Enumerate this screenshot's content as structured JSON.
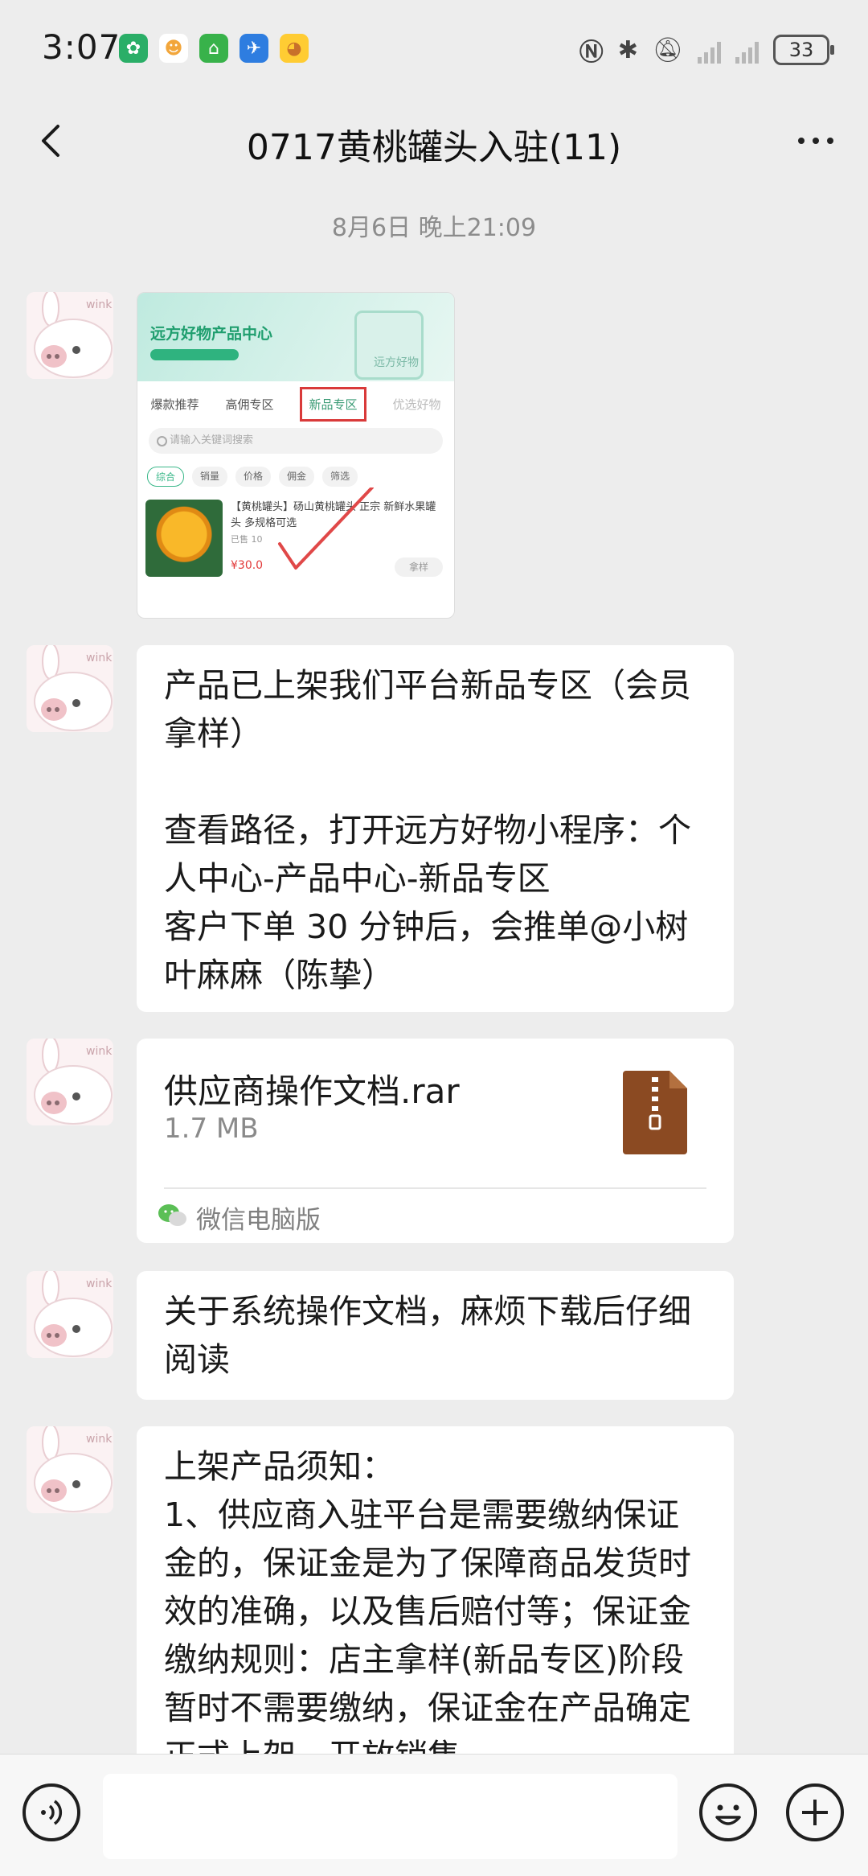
{
  "status_bar": {
    "time": "3:07",
    "battery": "33",
    "app_icons": [
      "wechat-pay-icon",
      "meituan-icon",
      "ctrip-icon",
      "flight-icon",
      "duck-app-icon"
    ],
    "icons": [
      "nfc-icon",
      "bluetooth-icon",
      "mute-icon",
      "signal-icon",
      "signal-icon"
    ]
  },
  "header": {
    "title": "0717黄桃罐头入驻(11)",
    "back_icon": "chevron-left-icon",
    "more_icon": "more-icon"
  },
  "timestamp": "8月6日 晚上21:09",
  "avatar_text": "wink",
  "image_message": {
    "header_title": "远方好物产品中心",
    "bag_label": "远方好物",
    "tabs": [
      "爆款推荐",
      "高佣专区",
      "新品专区",
      "优选好物"
    ],
    "search_placeholder": "请输入关键词搜索",
    "filters": [
      "综合",
      "销量",
      "价格",
      "佣金",
      "筛选"
    ],
    "product_title": "【黄桃罐头】砀山黄桃罐头 正宗 新鲜水果罐头 多规格可选",
    "product_meta": "已售 10",
    "price": "¥30.0",
    "buy_label": "拿样"
  },
  "messages": {
    "m1": "产品已上架我们平台新品专区（会员拿样）\n\n查看路径，打开远方好物小程序：个人中心-产品中心-新品专区\n客户下单 30 分钟后，会推单@小树叶麻麻（陈挚）",
    "m3": "关于系统操作文档，麻烦下载后仔细阅读",
    "m4": "上架产品须知：\n1、供应商入驻平台是需要缴纳保证金的，保证金是为了保障商品发货时效的准确，以及售后赔付等；保证金缴纳规则：店主拿样(新品专区)阶段暂时不需要缴纳，保证金在产品确定正式上架，开放销售"
  },
  "file_message": {
    "name": "供应商操作文档.rar",
    "size": "1.7 MB",
    "source": "微信电脑版",
    "file_icon": "zip-file-icon",
    "source_icon": "wechat-icon"
  },
  "input_bar": {
    "voice_icon": "voice-icon",
    "emoji_icon": "emoji-icon",
    "plus_icon": "plus-icon",
    "input_value": ""
  },
  "colors": {
    "background": "#ededed",
    "bubble": "#ffffff",
    "file_icon": "#8b4a22",
    "accent_green": "#1f9e6e",
    "price_red": "#e23b3b"
  }
}
